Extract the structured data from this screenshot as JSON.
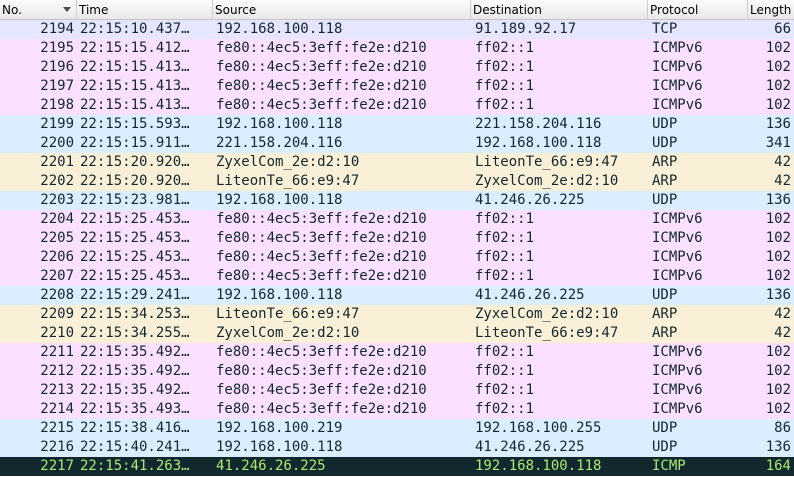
{
  "columns": {
    "no": "No.",
    "time": "Time",
    "source": "Source",
    "destination": "Destination",
    "protocol": "Protocol",
    "length": "Length"
  },
  "colors": {
    "tcp": "#e7e6ff",
    "icmpv6": "#fce0ff",
    "udp": "#daeeff",
    "arp": "#faf0d7",
    "selected_bg": "#12272e",
    "selected_fg": "#a8ec6f"
  },
  "packets": [
    {
      "no": "2194",
      "time": "22:15:10.437…",
      "source": "192.168.100.118",
      "destination": "91.189.92.17",
      "protocol": "TCP",
      "length": "66",
      "color": "tcp"
    },
    {
      "no": "2195",
      "time": "22:15:15.412…",
      "source": "fe80::4ec5:3eff:fe2e:d210",
      "destination": "ff02::1",
      "protocol": "ICMPv6",
      "length": "102",
      "color": "icmpv6"
    },
    {
      "no": "2196",
      "time": "22:15:15.413…",
      "source": "fe80::4ec5:3eff:fe2e:d210",
      "destination": "ff02::1",
      "protocol": "ICMPv6",
      "length": "102",
      "color": "icmpv6"
    },
    {
      "no": "2197",
      "time": "22:15:15.413…",
      "source": "fe80::4ec5:3eff:fe2e:d210",
      "destination": "ff02::1",
      "protocol": "ICMPv6",
      "length": "102",
      "color": "icmpv6"
    },
    {
      "no": "2198",
      "time": "22:15:15.413…",
      "source": "fe80::4ec5:3eff:fe2e:d210",
      "destination": "ff02::1",
      "protocol": "ICMPv6",
      "length": "102",
      "color": "icmpv6"
    },
    {
      "no": "2199",
      "time": "22:15:15.593…",
      "source": "192.168.100.118",
      "destination": "221.158.204.116",
      "protocol": "UDP",
      "length": "136",
      "color": "udp"
    },
    {
      "no": "2200",
      "time": "22:15:15.911…",
      "source": "221.158.204.116",
      "destination": "192.168.100.118",
      "protocol": "UDP",
      "length": "341",
      "color": "udp"
    },
    {
      "no": "2201",
      "time": "22:15:20.920…",
      "source": "ZyxelCom_2e:d2:10",
      "destination": "LiteonTe_66:e9:47",
      "protocol": "ARP",
      "length": "42",
      "color": "arp"
    },
    {
      "no": "2202",
      "time": "22:15:20.920…",
      "source": "LiteonTe_66:e9:47",
      "destination": "ZyxelCom_2e:d2:10",
      "protocol": "ARP",
      "length": "42",
      "color": "arp"
    },
    {
      "no": "2203",
      "time": "22:15:23.981…",
      "source": "192.168.100.118",
      "destination": "41.246.26.225",
      "protocol": "UDP",
      "length": "136",
      "color": "udp"
    },
    {
      "no": "2204",
      "time": "22:15:25.453…",
      "source": "fe80::4ec5:3eff:fe2e:d210",
      "destination": "ff02::1",
      "protocol": "ICMPv6",
      "length": "102",
      "color": "icmpv6"
    },
    {
      "no": "2205",
      "time": "22:15:25.453…",
      "source": "fe80::4ec5:3eff:fe2e:d210",
      "destination": "ff02::1",
      "protocol": "ICMPv6",
      "length": "102",
      "color": "icmpv6"
    },
    {
      "no": "2206",
      "time": "22:15:25.453…",
      "source": "fe80::4ec5:3eff:fe2e:d210",
      "destination": "ff02::1",
      "protocol": "ICMPv6",
      "length": "102",
      "color": "icmpv6"
    },
    {
      "no": "2207",
      "time": "22:15:25.453…",
      "source": "fe80::4ec5:3eff:fe2e:d210",
      "destination": "ff02::1",
      "protocol": "ICMPv6",
      "length": "102",
      "color": "icmpv6"
    },
    {
      "no": "2208",
      "time": "22:15:29.241…",
      "source": "192.168.100.118",
      "destination": "41.246.26.225",
      "protocol": "UDP",
      "length": "136",
      "color": "udp"
    },
    {
      "no": "2209",
      "time": "22:15:34.253…",
      "source": "LiteonTe_66:e9:47",
      "destination": "ZyxelCom_2e:d2:10",
      "protocol": "ARP",
      "length": "42",
      "color": "arp"
    },
    {
      "no": "2210",
      "time": "22:15:34.255…",
      "source": "ZyxelCom_2e:d2:10",
      "destination": "LiteonTe_66:e9:47",
      "protocol": "ARP",
      "length": "42",
      "color": "arp"
    },
    {
      "no": "2211",
      "time": "22:15:35.492…",
      "source": "fe80::4ec5:3eff:fe2e:d210",
      "destination": "ff02::1",
      "protocol": "ICMPv6",
      "length": "102",
      "color": "icmpv6"
    },
    {
      "no": "2212",
      "time": "22:15:35.492…",
      "source": "fe80::4ec5:3eff:fe2e:d210",
      "destination": "ff02::1",
      "protocol": "ICMPv6",
      "length": "102",
      "color": "icmpv6"
    },
    {
      "no": "2213",
      "time": "22:15:35.492…",
      "source": "fe80::4ec5:3eff:fe2e:d210",
      "destination": "ff02::1",
      "protocol": "ICMPv6",
      "length": "102",
      "color": "icmpv6"
    },
    {
      "no": "2214",
      "time": "22:15:35.493…",
      "source": "fe80::4ec5:3eff:fe2e:d210",
      "destination": "ff02::1",
      "protocol": "ICMPv6",
      "length": "102",
      "color": "icmpv6"
    },
    {
      "no": "2215",
      "time": "22:15:38.416…",
      "source": "192.168.100.219",
      "destination": "192.168.100.255",
      "protocol": "UDP",
      "length": "86",
      "color": "udp"
    },
    {
      "no": "2216",
      "time": "22:15:40.241…",
      "source": "192.168.100.118",
      "destination": "41.246.26.225",
      "protocol": "UDP",
      "length": "136",
      "color": "udp"
    },
    {
      "no": "2217",
      "time": "22:15:41.263…",
      "source": "41.246.26.225",
      "destination": "192.168.100.118",
      "protocol": "ICMP",
      "length": "164",
      "color": "selected",
      "selected": true
    }
  ]
}
